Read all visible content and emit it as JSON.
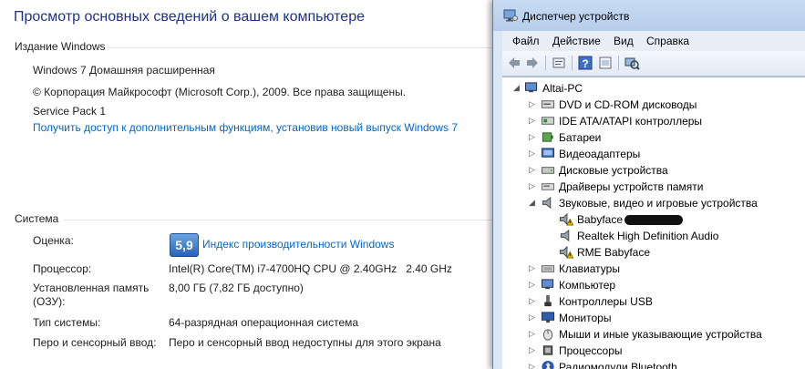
{
  "system": {
    "title": "Просмотр основных сведений о вашем компьютере",
    "edition_heading": "Издание Windows",
    "edition": "Windows 7 Домашняя расширенная",
    "copyright": "© Корпорация Майкрософт (Microsoft Corp.), 2009. Все права защищены.",
    "service_pack": "Service Pack 1",
    "upgrade_link": "Получить доступ к дополнительным функциям, установив новый выпуск Windows 7",
    "system_heading": "Система",
    "rating_label": "Оценка:",
    "rating_score": "5,9",
    "rating_link": "Индекс производительности Windows",
    "cpu_label": "Процессор:",
    "cpu_value": "Intel(R) Core(TM) i7-4700HQ CPU @ 2.40GHz   2.40 GHz",
    "ram_label_1": "Установленная память",
    "ram_label_2": "(ОЗУ):",
    "ram_value": "8,00 ГБ (7,82 ГБ доступно)",
    "type_label": "Тип системы:",
    "type_value": "64-разрядная операционная система",
    "pen_label": "Перо и сенсорный ввод:",
    "pen_value": "Перо и сенсорный ввод недоступны для этого экрана"
  },
  "device_manager": {
    "title": "Диспетчер устройств",
    "menu": [
      "Файл",
      "Действие",
      "Вид",
      "Справка"
    ],
    "toolbar_icons": [
      "back-icon",
      "forward-icon",
      "properties-icon",
      "help-icon",
      "view-icon",
      "scan-hardware-icon"
    ],
    "root": "Altai-PC",
    "tree": [
      {
        "label": "DVD и CD-ROM дисководы",
        "icon": "dvd-icon",
        "expanded": false
      },
      {
        "label": "IDE ATA/ATAPI контроллеры",
        "icon": "ide-controller-icon",
        "expanded": false
      },
      {
        "label": "Батареи",
        "icon": "battery-icon",
        "expanded": false
      },
      {
        "label": "Видеоадаптеры",
        "icon": "display-adapter-icon",
        "expanded": false
      },
      {
        "label": "Дисковые устройства",
        "icon": "disk-drive-icon",
        "expanded": false
      },
      {
        "label": "Драйверы устройств памяти",
        "icon": "storage-driver-icon",
        "expanded": false
      },
      {
        "label": "Звуковые, видео и игровые устройства",
        "icon": "sound-icon",
        "expanded": true
      },
      {
        "label": "Клавиатуры",
        "icon": "keyboard-icon",
        "expanded": false
      },
      {
        "label": "Компьютер",
        "icon": "computer-icon",
        "expanded": false
      },
      {
        "label": "Контроллеры USB",
        "icon": "usb-icon",
        "expanded": false
      },
      {
        "label": "Мониторы",
        "icon": "monitor-icon",
        "expanded": false
      },
      {
        "label": "Мыши и иные указывающие устройства",
        "icon": "mouse-icon",
        "expanded": false
      },
      {
        "label": "Процессоры",
        "icon": "processor-icon",
        "expanded": false
      },
      {
        "label": "Радиомодули Bluetooth",
        "icon": "bluetooth-icon",
        "expanded": false
      }
    ],
    "sound_children": [
      {
        "label": "Babyface",
        "warning": true,
        "redacted": true
      },
      {
        "label": "Realtek High Definition Audio",
        "warning": false,
        "redacted": false
      },
      {
        "label": "RME Babyface",
        "warning": true,
        "redacted": false
      }
    ]
  },
  "colors": {
    "title_blue": "#1e3287",
    "link_blue": "#0066cc",
    "window_frame": "#dbe7f5",
    "warning_yellow": "#f5c400"
  }
}
